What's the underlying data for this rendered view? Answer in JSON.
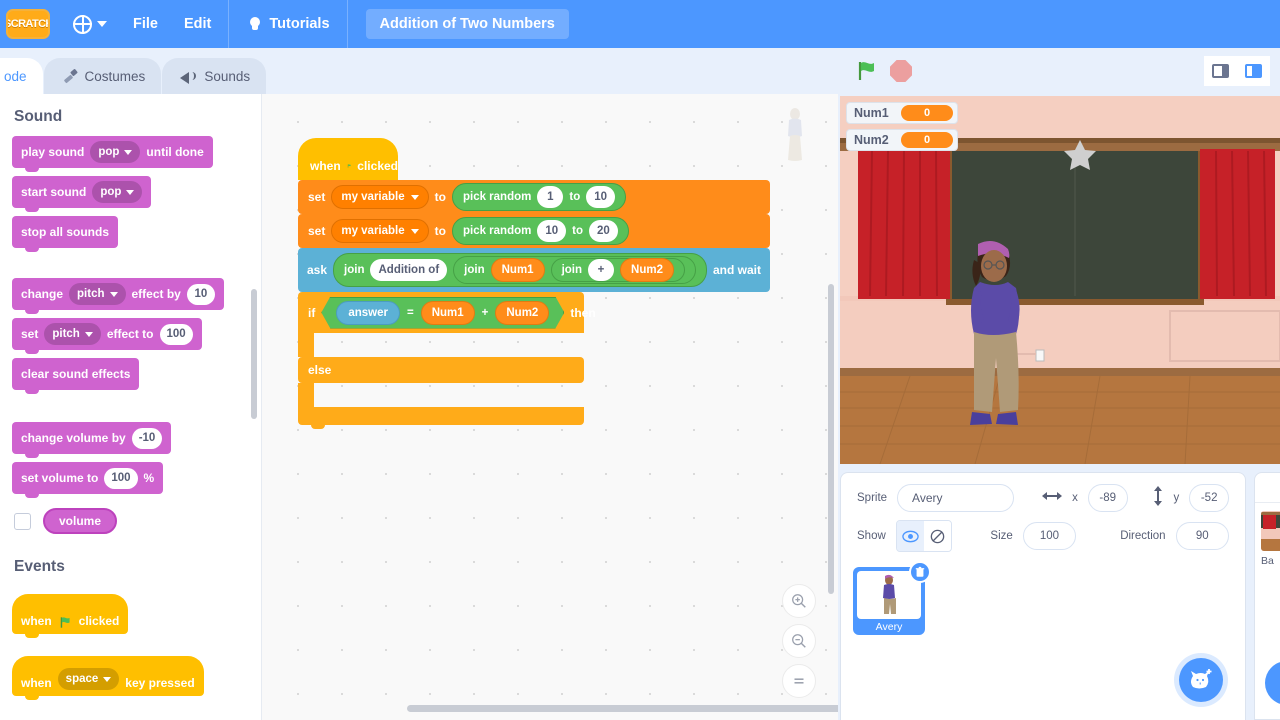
{
  "menu": {
    "language_icon": "globe-icon",
    "file": "File",
    "edit": "Edit",
    "tutorials": "Tutorials",
    "tutorials_icon": "lightbulb-icon",
    "project_title": "Addition of Two Numbers",
    "logo": "scratch-logo"
  },
  "tabs": [
    {
      "label": "ode",
      "icon": "code-icon",
      "active": true
    },
    {
      "label": "Costumes",
      "icon": "brush-icon",
      "active": false
    },
    {
      "label": "Sounds",
      "icon": "speaker-icon",
      "active": false
    }
  ],
  "stage_controls": {
    "green_flag": "green-flag-icon",
    "stop": "stop-icon",
    "small_stage": "small-stage-layout-icon",
    "large_stage": "large-stage-layout-icon"
  },
  "palette": {
    "sound_category": "Sound",
    "events_category": "Events",
    "sound_blocks": [
      {
        "id": "play-sound-until-done",
        "parts": [
          "play sound",
          "pop",
          "until done"
        ],
        "dropdown": "pop"
      },
      {
        "id": "start-sound",
        "parts": [
          "start sound",
          "pop"
        ],
        "dropdown": "pop"
      },
      {
        "id": "stop-all-sounds",
        "parts": [
          "stop all sounds"
        ]
      },
      {
        "id": "change-effect-by",
        "parts": [
          "change",
          "pitch",
          "effect by",
          "10"
        ],
        "dropdown": "pitch",
        "value": "10"
      },
      {
        "id": "set-effect-to",
        "parts": [
          "set",
          "pitch",
          "effect to",
          "100"
        ],
        "dropdown": "pitch",
        "value": "100"
      },
      {
        "id": "clear-sound-effects",
        "parts": [
          "clear sound effects"
        ]
      },
      {
        "id": "change-volume-by",
        "parts": [
          "change volume by",
          "-10"
        ],
        "value": "-10"
      },
      {
        "id": "set-volume-to",
        "parts": [
          "set volume to",
          "100",
          "%"
        ],
        "value": "100"
      }
    ],
    "volume_reporter": "volume",
    "events_blocks": [
      {
        "id": "when-flag-clicked",
        "prefix": "when",
        "suffix": "clicked"
      },
      {
        "id": "when-key-pressed",
        "prefix": "when",
        "dropdown": "space",
        "suffix": "key pressed"
      }
    ]
  },
  "script": {
    "hat": {
      "prefix": "when",
      "icon": "green-flag-icon",
      "suffix": "clicked"
    },
    "set1": {
      "op": "set",
      "variable": "my variable",
      "to": "to",
      "fn": "pick random",
      "from": "1",
      "mid": "to",
      "until": "10"
    },
    "set2": {
      "op": "set",
      "variable": "my variable",
      "to": "to",
      "fn": "pick random",
      "from": "10",
      "mid": "to",
      "until": "20"
    },
    "ask": {
      "op": "ask",
      "join1": "join",
      "text1": "Addition of",
      "join2": "join",
      "var1": "Num1",
      "join3": "join",
      "plus": "+",
      "var2": "Num2",
      "tail": "and wait"
    },
    "ifelse": {
      "if": "if",
      "answer": "answer",
      "equals": "=",
      "left": "Num1",
      "op": "+",
      "right": "Num2",
      "then": "then",
      "else": "else"
    }
  },
  "workspace_controls": {
    "zoom_in": "zoom-in-icon",
    "zoom_out": "zoom-out-icon",
    "zoom_reset": "zoom-reset-icon"
  },
  "stage": {
    "monitors": [
      {
        "name": "Num1",
        "value": "0"
      },
      {
        "name": "Num2",
        "value": "0"
      }
    ],
    "backdrop_description": "auditorium-backdrop",
    "sprite_on_stage": "Avery"
  },
  "sprite_info": {
    "sprite_label": "Sprite",
    "sprite_name": "Avery",
    "x_label": "x",
    "x_value": "-89",
    "y_label": "y",
    "y_value": "-52",
    "show_label": "Show",
    "show_on_icon": "eye-icon",
    "show_off_icon": "eye-slash-icon",
    "size_label": "Size",
    "size_value": "100",
    "direction_label": "Direction",
    "direction_value": "90",
    "add_sprite_icon": "add-sprite-cat-icon"
  },
  "sprite_list": [
    {
      "name": "Avery",
      "selected": true,
      "delete_icon": "trash-icon"
    }
  ],
  "backdrop_panel": {
    "name": "Ba",
    "add_backdrop_icon": "add-backdrop-icon"
  },
  "colors": {
    "brand_blue": "#4c97ff",
    "sound_purple": "#cf63cf",
    "events_yellow": "#ffbf00",
    "variables_orange": "#ff8c1a",
    "operators_green": "#59c059",
    "sensing_blue": "#5cb1d6",
    "control_amber": "#ffab19"
  }
}
